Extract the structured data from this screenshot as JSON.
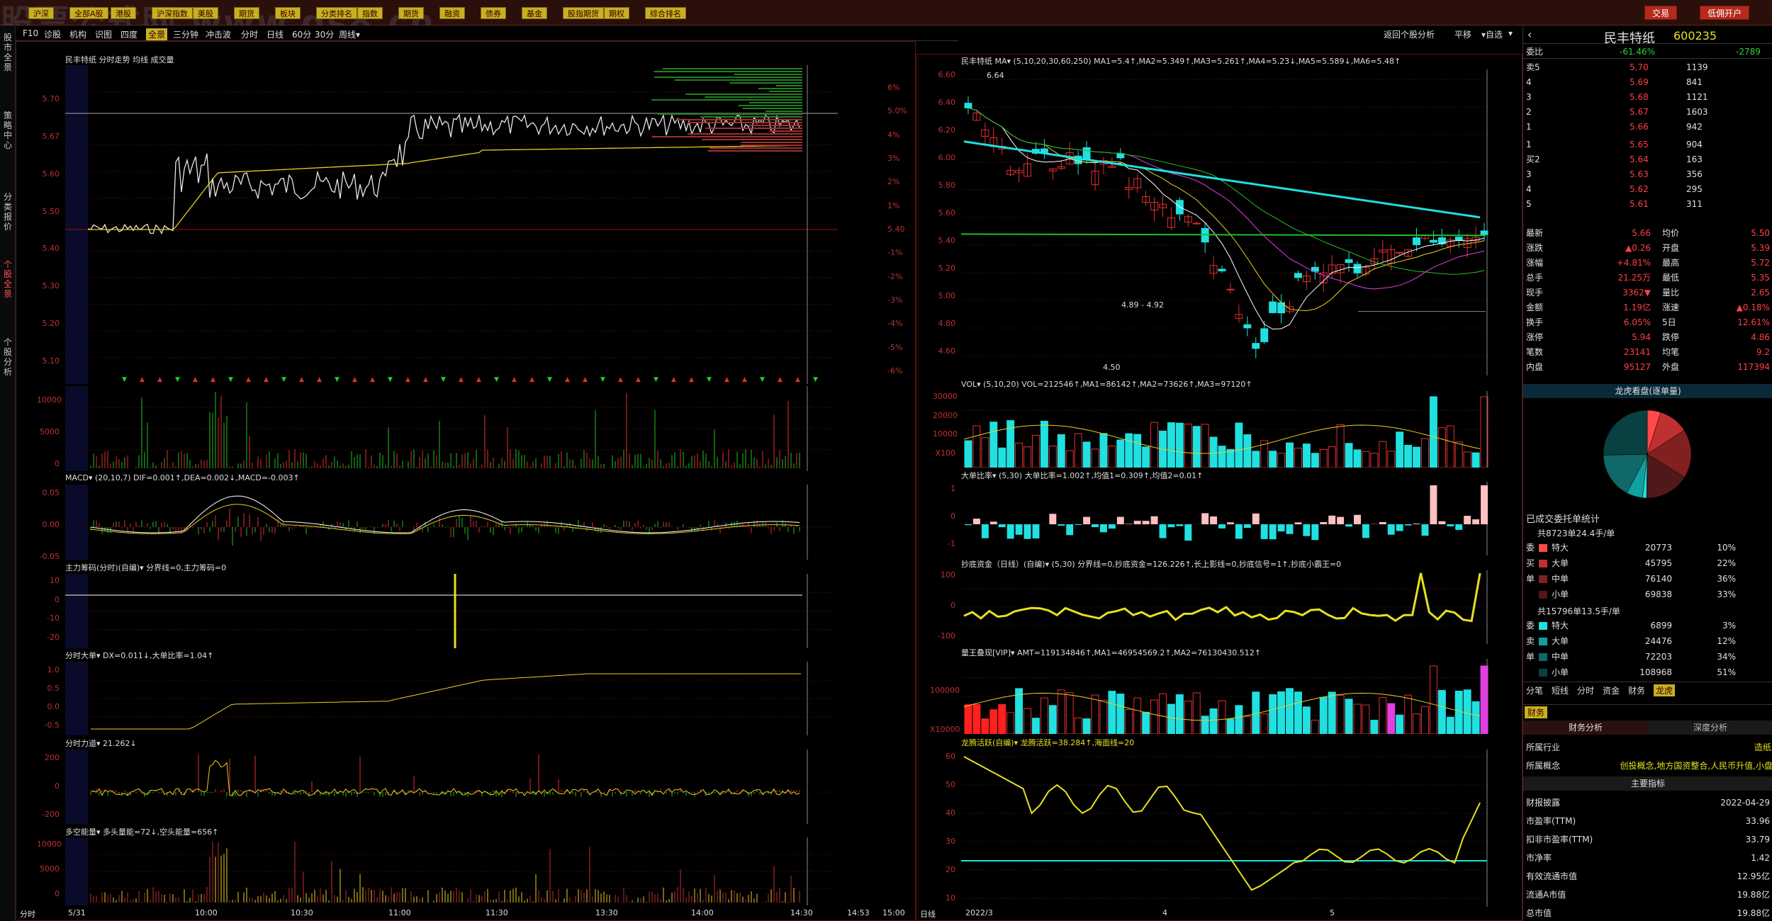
{
  "watermark": "股票公式网  www.gs8.cn",
  "toolbar": {
    "buttons": [
      "沪深",
      "全部A股",
      "港股",
      "沪深指数",
      "美股",
      "期货",
      "板块",
      "分类排名",
      "指数",
      "期货",
      "融资",
      "债券",
      "基金",
      "股指期货",
      "期权",
      "综合排名"
    ],
    "trade": "交易",
    "open_account": "低佣开户"
  },
  "left_tabs": [
    "股市全景",
    "策略中心",
    "分类报价",
    "个股全景",
    "个股分析"
  ],
  "sub_tabs": [
    "F10",
    "诊股",
    "机构",
    "识图",
    "四度",
    "全景",
    "三分钟",
    "冲击波",
    "分时",
    "日线",
    "60分",
    "30分",
    "周线▾"
  ],
  "sub_tabs_right": [
    "返回个股分析",
    "平移",
    "▾自选",
    "▾"
  ],
  "intraday": {
    "title": "民丰特纸  分时走势  均线 成交量",
    "price_axis": [
      "5.70",
      "5.67",
      "5.60",
      "5.50",
      "5.40",
      "5.30",
      "5.20",
      "5.10"
    ],
    "pct_axis": [
      "6%",
      "5.0%",
      "4%",
      "3%",
      "2%",
      "1%",
      "5.40",
      "-1%",
      "-2%",
      "-3%",
      "-4%",
      "-5%",
      "-6%"
    ],
    "vol_axis": [
      "10000",
      "5000",
      "0"
    ],
    "macd_title": "MACD▾  (20,10,7)  DIF=0.001↑,DEA=0.002↓,MACD=-0.003↑",
    "macd_axis": [
      "0.05",
      "0.00",
      "-0.05"
    ],
    "zlcm_title": "主力筹码(分时)(自编)▾  分界线=0,主力筹码=0",
    "zlcm_axis": [
      "10",
      "0",
      "-10",
      "-20"
    ],
    "fsdd_title": "分时大单▾  DX=0.011↓,大单比率=1.04↑",
    "fsdd_axis": [
      "1.0",
      "0.5",
      "0.0",
      "-0.5"
    ],
    "fsld_title": "分时力道▾  21.262↓",
    "fsld_axis": [
      "200",
      "0",
      "-200"
    ],
    "dkn_title": "多空能量▾  多头量能=72↓,空头能量=656↑",
    "dkn_axis": [
      "10000",
      "5000",
      "0"
    ],
    "time_axis": [
      "分时",
      "5/31",
      "10:00",
      "10:30",
      "11:00",
      "11:30",
      "13:30",
      "14:00",
      "14:30",
      "14:53",
      "15:00"
    ]
  },
  "daily": {
    "ma_title": "民丰特纸  MA▾ (5,10,20,30,60,250)  MA1=5.4↑,MA2=5.349↑,MA3=5.261↑,MA4=5.23↓,MA5=5.589↓,MA6=5.48↑",
    "price_axis": [
      "6.60",
      "6.40",
      "6.20",
      "6.00",
      "5.80",
      "5.60",
      "5.40",
      "5.20",
      "5.00",
      "4.80",
      "4.60"
    ],
    "hi_label": "6.64",
    "lo_label": "4.50",
    "range_label": "4.89 - 4.92",
    "vol_title": "VOL▾  (5,10,20)  VOL=212546↑,MA1=86142↑,MA2=73626↑,MA3=97120↑",
    "vol_axis": [
      "30000",
      "20000",
      "10000",
      "X100"
    ],
    "ddbl_title": "大单比率▾ (5,30)  大单比率=1.002↑,均值1=0.309↑,均值2=0.01↑",
    "ddbl_axis": [
      "1",
      "0",
      "-1"
    ],
    "cdzj_title": "抄底资金（日线）(自编)▾  (5,30)  分界线=0,抄底资金=126.226↑,长上影线=0,抄底信号=1↑,抄底小霸王=0",
    "cdzj_axis": [
      "100",
      "0",
      "-100"
    ],
    "ljdx_title": "量王叠现[VIP]▾  AMT=119134846↑,MA1=46954569.2↑,MA2=76130430.512↑",
    "ljdx_axis": [
      "100000",
      "X10000"
    ],
    "lthy_title": "龙腾活跃(自编)▾  龙腾活跃=38.284↑,海面线=20",
    "lthy_axis": [
      "60",
      "50",
      "40",
      "30",
      "20",
      "10"
    ],
    "date_axis": [
      "日线",
      "2022/3",
      "4",
      "5"
    ]
  },
  "quote": {
    "name": "民丰特纸",
    "code": "600235",
    "webi_label": "委比",
    "webi": "-61.46%",
    "wecha": "-2789",
    "asks": [
      {
        "l": "卖5",
        "p": "5.70",
        "v": "1139"
      },
      {
        "l": "4",
        "p": "5.69",
        "v": "841"
      },
      {
        "l": "3",
        "p": "5.68",
        "v": "1121"
      },
      {
        "l": "2",
        "p": "5.67",
        "v": "1603"
      },
      {
        "l": "1",
        "p": "5.66",
        "v": "942"
      }
    ],
    "bids": [
      {
        "l": "1",
        "p": "5.65",
        "v": "904"
      },
      {
        "l": "买2",
        "p": "5.64",
        "v": "163"
      },
      {
        "l": "3",
        "p": "5.63",
        "v": "356"
      },
      {
        "l": "4",
        "p": "5.62",
        "v": "295"
      },
      {
        "l": "5",
        "p": "5.61",
        "v": "311"
      }
    ],
    "stats": [
      {
        "a": "最新",
        "b": "5.66",
        "c": "均价",
        "d": "5.50"
      },
      {
        "a": "涨跌",
        "b": "▲0.26",
        "c": "开盘",
        "d": "5.39"
      },
      {
        "a": "涨幅",
        "b": "+4.81%",
        "c": "最高",
        "d": "5.72"
      },
      {
        "a": "总手",
        "b": "21.25万",
        "c": "最低",
        "d": "5.35"
      },
      {
        "a": "现手",
        "b": "3362▼",
        "c": "量比",
        "d": "2.65"
      },
      {
        "a": "金额",
        "b": "1.19亿",
        "c": "涨速",
        "d": "▲0.18%"
      },
      {
        "a": "换手",
        "b": "6.05%",
        "c": "5日",
        "d": "12.61%"
      },
      {
        "a": "涨停",
        "b": "5.94",
        "c": "跌停",
        "d": "4.86"
      },
      {
        "a": "笔数",
        "b": "23141",
        "c": "均笔",
        "d": "9.2"
      },
      {
        "a": "内盘",
        "b": "95127",
        "c": "外盘",
        "d": "117394"
      }
    ],
    "pie_title": "龙虎看盘(逐单量)",
    "dist_title": "已成交委托单统计",
    "buy_total": "共8723单24.4手/单",
    "buy_rows": [
      {
        "n": "特大",
        "v": "20773",
        "p": "10%",
        "c": "#ff4a4a"
      },
      {
        "n": "大单",
        "v": "45795",
        "p": "22%",
        "c": "#c03030"
      },
      {
        "n": "中单",
        "v": "76140",
        "p": "36%",
        "c": "#802020"
      },
      {
        "n": "小单",
        "v": "69838",
        "p": "33%",
        "c": "#501818"
      }
    ],
    "sell_total": "共15796单13.5手/单",
    "sell_rows": [
      {
        "n": "特大",
        "v": "6899",
        "p": "3%",
        "c": "#20e0e0"
      },
      {
        "n": "大单",
        "v": "24476",
        "p": "12%",
        "c": "#10a0a0"
      },
      {
        "n": "中单",
        "v": "72203",
        "p": "34%",
        "c": "#106868"
      },
      {
        "n": "小单",
        "v": "108968",
        "p": "51%",
        "c": "#0a4040"
      }
    ],
    "side_buy": [
      "委",
      "买",
      "单"
    ],
    "side_sell": [
      "委",
      "卖",
      "单"
    ],
    "tabs": [
      "分笔",
      "短线",
      "分时",
      "资金",
      "财务",
      "龙虎"
    ],
    "fin_tab": "财务",
    "fin_tabs": [
      "财务分析",
      "深度分析"
    ],
    "industry_label": "所属行业",
    "industry": "造纸",
    "concept_label": "所属概念",
    "concept": "创投概念,地方国资整合,人民币升值,小盘",
    "main_index": "主要指标",
    "fin_rows": [
      {
        "a": "财报披露",
        "b": "2022-04-29"
      },
      {
        "a": "市盈率(TTM)",
        "b": "33.96"
      },
      {
        "a": "扣非市盈率(TTM)",
        "b": "33.79"
      },
      {
        "a": "市净率",
        "b": "1.42"
      },
      {
        "a": "有效流通市值",
        "b": "12.95亿"
      },
      {
        "a": "流通A市值",
        "b": "19.88亿"
      },
      {
        "a": "总市值",
        "b": "19.88亿"
      }
    ]
  },
  "pie": [
    {
      "v": 10,
      "c": "#ff4a4a"
    },
    {
      "v": 22,
      "c": "#c03030"
    },
    {
      "v": 36,
      "c": "#802020"
    },
    {
      "v": 33,
      "c": "#501818"
    },
    {
      "v": 3,
      "c": "#20e0e0"
    },
    {
      "v": 12,
      "c": "#10a0a0"
    },
    {
      "v": 34,
      "c": "#106868"
    },
    {
      "v": 51,
      "c": "#0a4040"
    }
  ]
}
